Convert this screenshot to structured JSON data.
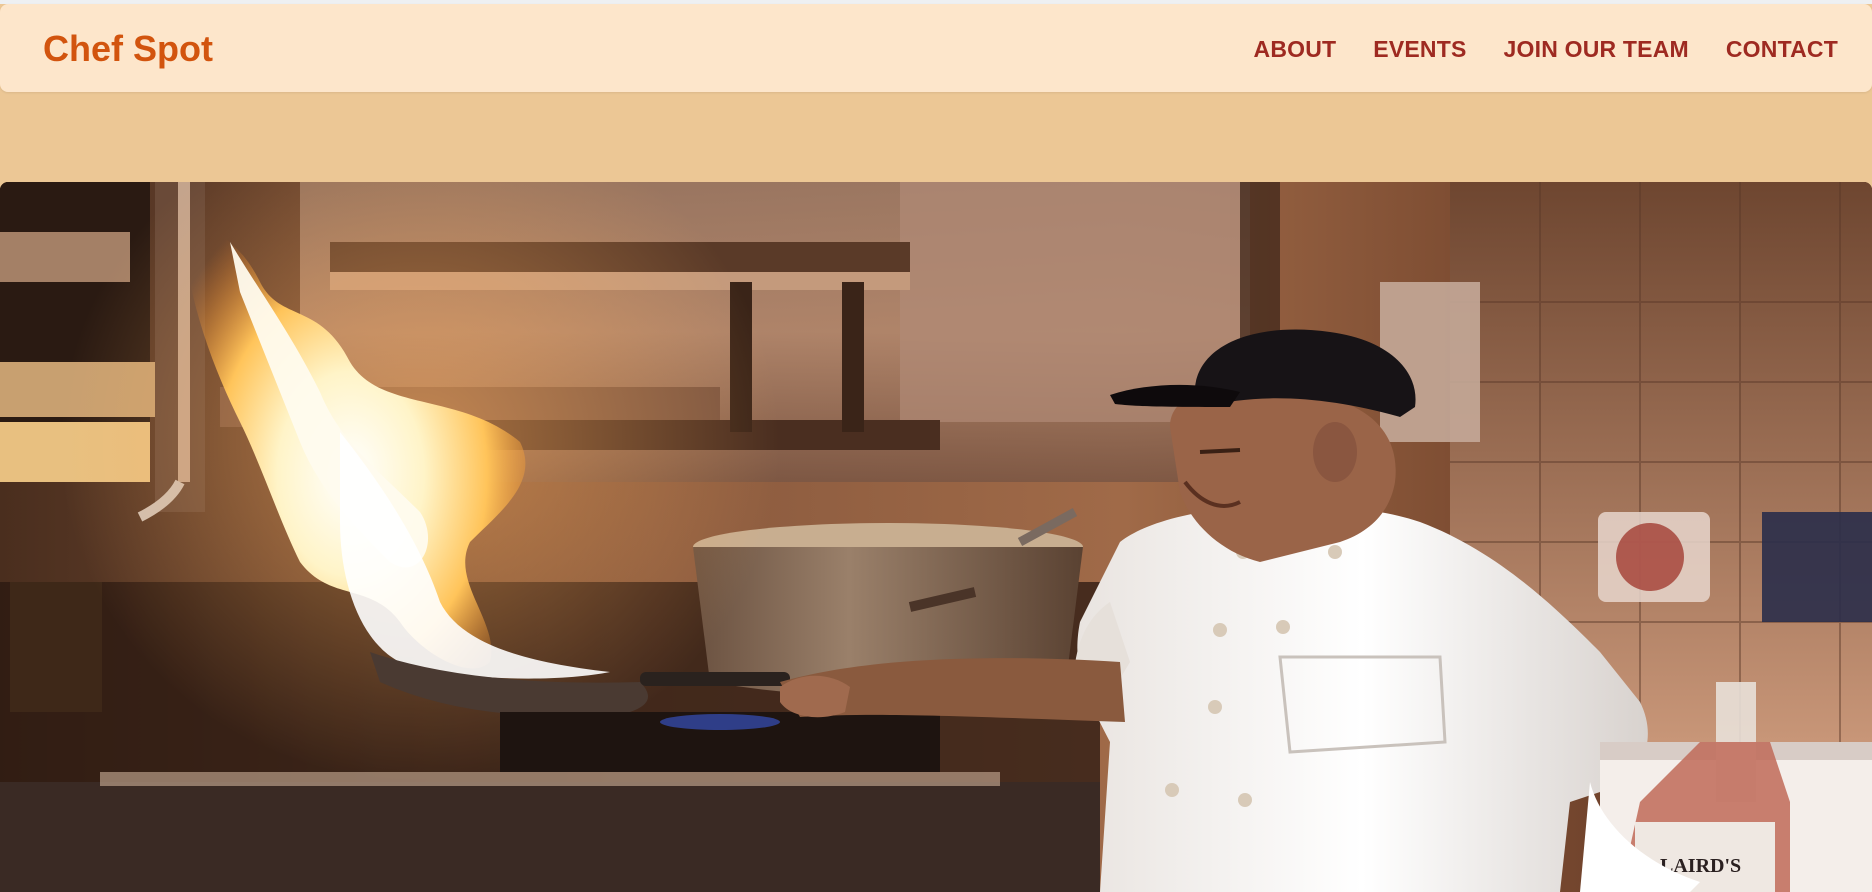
{
  "header": {
    "brand": "Chef Spot",
    "nav": [
      {
        "label": "ABOUT"
      },
      {
        "label": "EVENTS"
      },
      {
        "label": "JOIN OUR TEAM"
      },
      {
        "label": "CONTACT"
      }
    ]
  },
  "hero": {
    "bottle_label": "LAIRD'S"
  },
  "colors": {
    "page_background": "#ecc795",
    "navbar_background": "#fde6cb",
    "brand": "#d2540e",
    "nav_link": "#9e2a21"
  }
}
